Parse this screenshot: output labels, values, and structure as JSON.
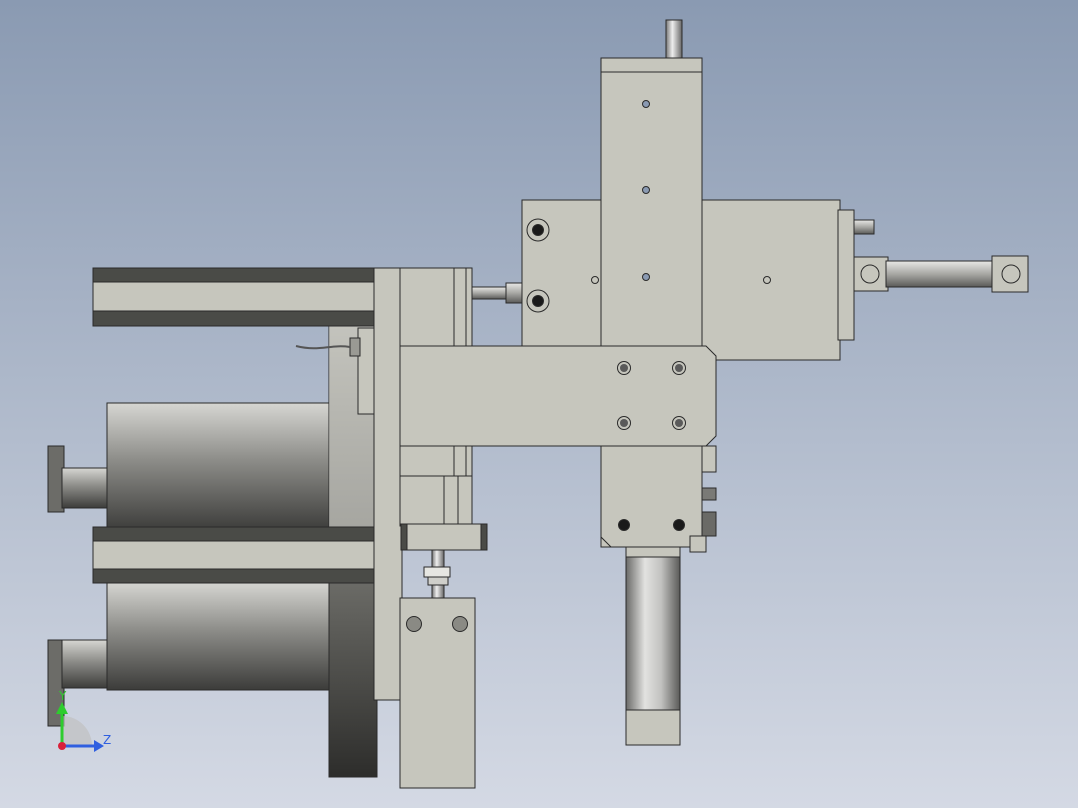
{
  "viewport": {
    "background_top": "#8a9ab2",
    "background_bottom": "#d4d9e4"
  },
  "colors": {
    "plate": "#c6c6bd",
    "plate_edge": "#2a2a2a",
    "dark_strip": "#4a4b47",
    "hole_fill": "#5a5a5a",
    "bolt_fill": "#1a1a1a",
    "cylinder_dark": "#4f4f4f",
    "cylinder_light": "#d8d8d8"
  },
  "triad": {
    "y_label": "Y",
    "z_label": "Z",
    "y_color": "#2ecc2e",
    "z_color": "#2f5fe0",
    "origin_color": "#d8203a"
  }
}
